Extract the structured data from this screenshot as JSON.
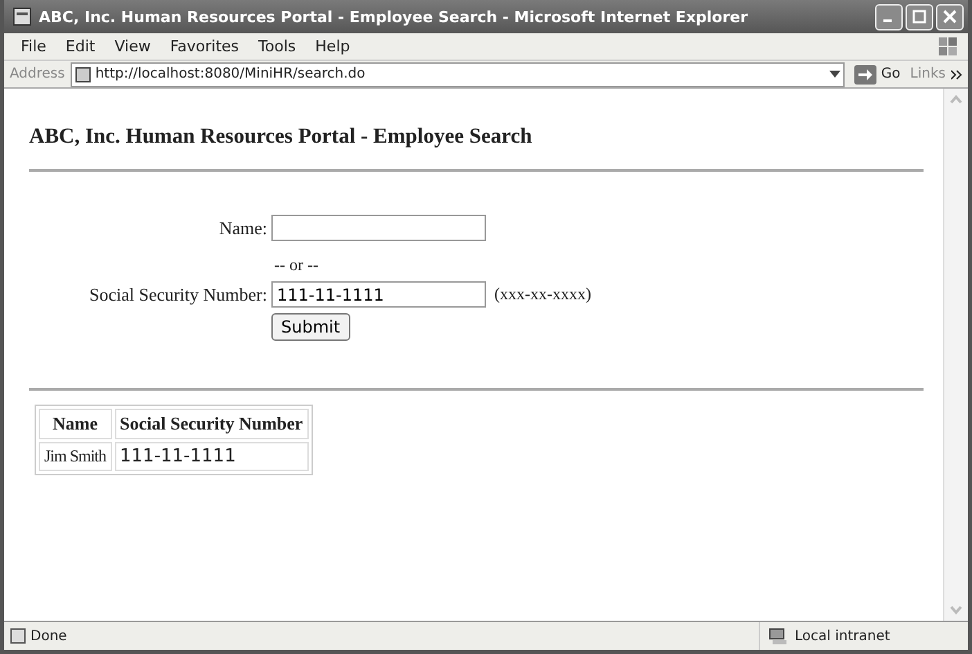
{
  "window": {
    "title": "ABC, Inc. Human Resources Portal - Employee Search - Microsoft Internet Explorer"
  },
  "menu": [
    "File",
    "Edit",
    "View",
    "Favorites",
    "Tools",
    "Help"
  ],
  "address_bar": {
    "label": "Address",
    "url": "http://localhost:8080/MiniHR/search.do",
    "go": "Go",
    "links": "Links"
  },
  "page": {
    "heading": "ABC, Inc. Human Resources Portal - Employee Search",
    "form": {
      "name": {
        "label": "Name:"
      },
      "separator": "-- or --",
      "ssn": {
        "label": "Social Security Number:",
        "value": "111-11-1111",
        "hint": "(xxx-xx-xxxx)"
      },
      "submit": "Submit"
    },
    "table": {
      "columns": [
        "Name",
        "Social Security Number"
      ],
      "rows": [
        [
          "Jim Smith",
          "111-11-1111"
        ]
      ]
    }
  },
  "status_bar": {
    "text": "Done",
    "zone": "Local intranet"
  }
}
